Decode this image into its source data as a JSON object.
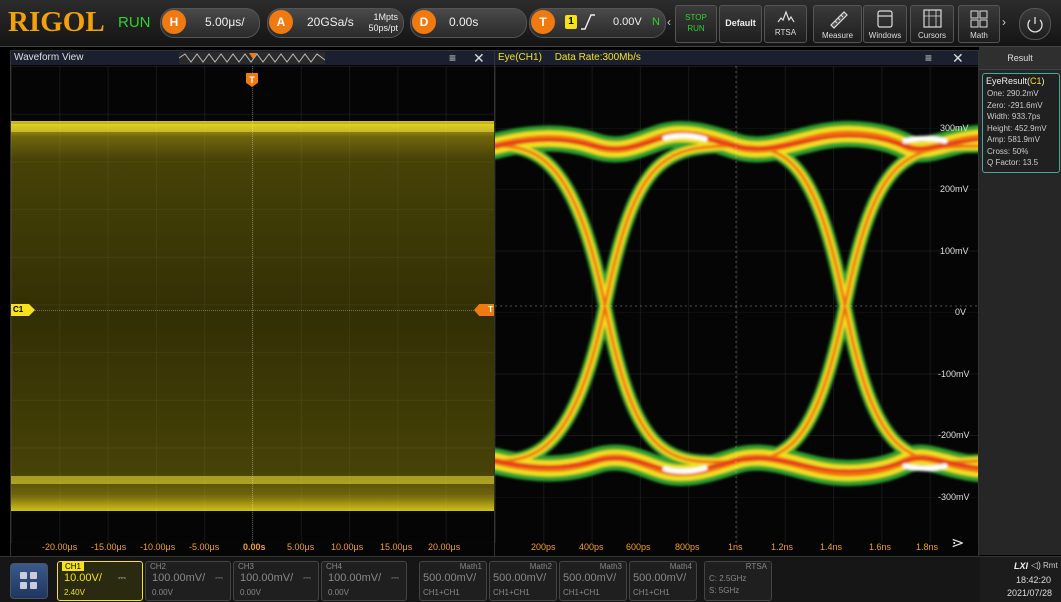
{
  "topbar": {
    "brand": "RIGOL",
    "run_state": "RUN",
    "horizontal": {
      "letter": "H",
      "value": "5.00μs/"
    },
    "acquire": {
      "letter": "A",
      "sample_rate": "20GSa/s",
      "memory_depth": "1Mpts",
      "points": "50ps/pt"
    },
    "delay": {
      "letter": "D",
      "value": "0.00s"
    },
    "trigger": {
      "letter": "T",
      "source": "1",
      "level": "0.00V",
      "mode": "N"
    },
    "buttons": {
      "stop": "STOP",
      "run": "RUN",
      "default": "Default",
      "rtsa": "RTSA",
      "measure": "Measure",
      "windows": "Windows",
      "cursors": "Cursors",
      "math": "Math"
    }
  },
  "waveform_view": {
    "title": "Waveform View",
    "marker_ch": "C1",
    "marker_t": "T",
    "x_ticks": [
      "-20.00μs",
      "-15.00μs",
      "-10.00μs",
      "-5.00μs",
      "0.00s",
      "5.00μs",
      "10.00μs",
      "15.00μs",
      "20.00μs"
    ]
  },
  "eye_view": {
    "title": "Eye(CH1)",
    "data_rate": "Data Rate:300Mb/s",
    "x_ticks": [
      "200ps",
      "400ps",
      "600ps",
      "800ps",
      "1ns",
      "1.2ns",
      "1.4ns",
      "1.6ns",
      "1.8ns"
    ],
    "y_ticks": [
      "300mV",
      "200mV",
      "100mV",
      "0V",
      "-100mV",
      "-200mV",
      "-300mV"
    ]
  },
  "result_panel": {
    "header": "Result",
    "title_prefix": "EyeResult(",
    "title_ch": "C1",
    "title_suffix": ")",
    "rows": [
      "One: 290.2mV",
      "Zero: -291.6mV",
      "Width: 933.7ps",
      "Height: 452.9mV",
      "Amp: 581.9mV",
      "Cross: 50%",
      "Q Factor: 13.5"
    ]
  },
  "channels": [
    {
      "name": "CH1",
      "scale": "10.00V/",
      "offset": "2.40V",
      "active": true
    },
    {
      "name": "CH2",
      "scale": "100.00mV/",
      "offset": "0.00V",
      "active": false
    },
    {
      "name": "CH3",
      "scale": "100.00mV/",
      "offset": "0.00V",
      "active": false
    },
    {
      "name": "CH4",
      "scale": "100.00mV/",
      "offset": "0.00V",
      "active": false
    }
  ],
  "maths": [
    {
      "name": "Math1",
      "scale": "500.00mV/",
      "expr": "CH1+CH1"
    },
    {
      "name": "Math2",
      "scale": "500.00mV/",
      "expr": "CH1+CH1"
    },
    {
      "name": "Math3",
      "scale": "500.00mV/",
      "expr": "CH1+CH1"
    },
    {
      "name": "Math4",
      "scale": "500.00mV/",
      "expr": "CH1+CH1"
    }
  ],
  "rtsa": {
    "name": "RTSA",
    "center": "C: 2.5GHz",
    "span": "S: 5GHz"
  },
  "status": {
    "lxi": "LXI",
    "rmt": "Rmt",
    "time": "18:42:20",
    "date": "2021/07/28"
  },
  "colors": {
    "accent": "#f2a10a",
    "ch1": "#f5e21a",
    "run": "#2fd12f",
    "trigger": "#f07a10"
  }
}
